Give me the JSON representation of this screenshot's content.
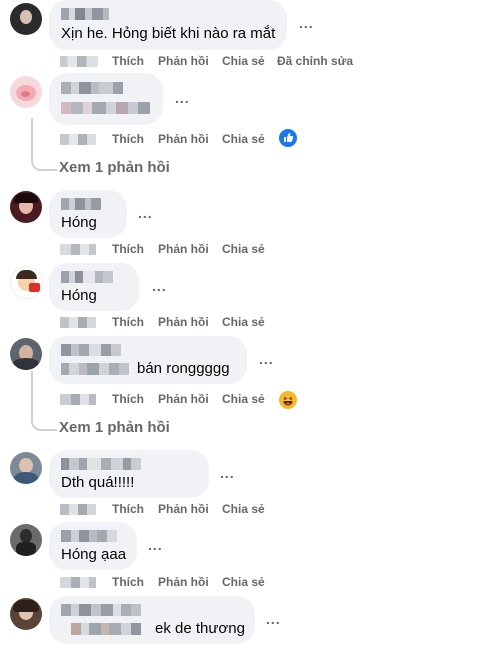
{
  "actions": {
    "like": "Thích",
    "reply": "Phản hồi",
    "share": "Chia sẻ",
    "edited": "Đã chỉnh sửa"
  },
  "more_label": "...",
  "comments": [
    {
      "text": "Xịn he. Hỏng biết khi nào ra mắt",
      "avatar_icon": "user-avatar-icon"
    },
    {
      "text": "",
      "avatar_icon": "pig-avatar-icon",
      "reaction_icon": "like-reaction-icon"
    },
    {
      "view_replies": "Xem 1 phản hồi"
    },
    {
      "text": "Hóng",
      "avatar_icon": "user-avatar-icon"
    },
    {
      "text": "Hóng",
      "avatar_icon": "cartoon-avatar-icon"
    },
    {
      "text": "bán ronggggg",
      "avatar_icon": "user-avatar-icon",
      "reaction_icon": "haha-reaction-icon"
    },
    {
      "view_replies": "Xem 1 phản hồi"
    },
    {
      "text": "Dth quá!!!!!",
      "avatar_icon": "user-avatar-icon"
    },
    {
      "text": "Hóng ạaa",
      "avatar_icon": "user-avatar-icon"
    },
    {
      "text": "ek de thương",
      "avatar_icon": "user-avatar-icon"
    }
  ],
  "colors": {
    "bubble": "#f0f2f5",
    "secondary_text": "#65676b",
    "like_blue": "#1877f2",
    "haha_yellow": "#f7b928"
  }
}
